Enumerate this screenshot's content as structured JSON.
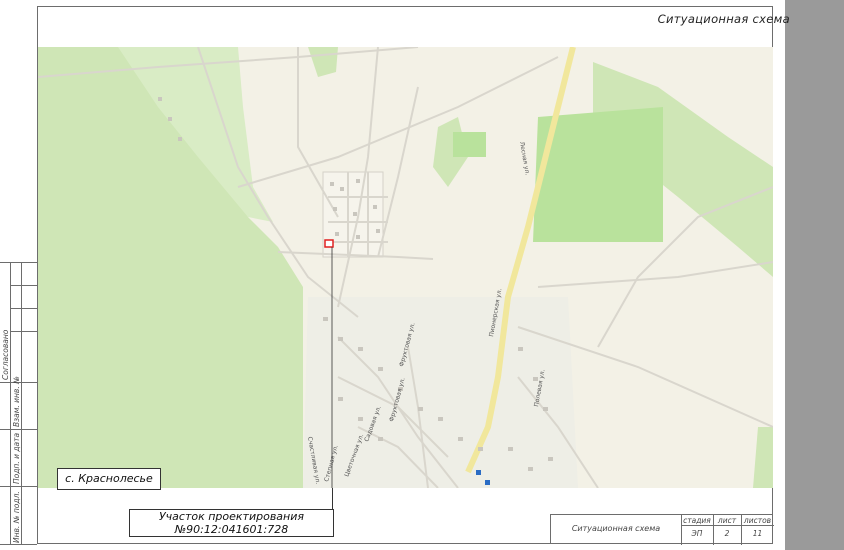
{
  "sheet": {
    "title": "Ситуационная схема",
    "place_name": "с. Краснолесье",
    "plot_label_line1": "Участок проектирования",
    "plot_label_line2": "№90:12:041601:728"
  },
  "side_stamp": {
    "agreed": "Согласовано",
    "ref_inv": "Взам. инв. №",
    "sign_date": "Подп. и дата",
    "inv_orig": "Инв. № подл."
  },
  "title_block": {
    "name": "Ситуационная схема",
    "stage_label": "стадия",
    "sheet_label": "лист",
    "sheets_label": "листов",
    "stage_value": "ЭП",
    "sheet_value": "2",
    "sheets_value": "11"
  },
  "map": {
    "streets": [
      "Пионерская ул.",
      "Фруктовая ул.",
      "Фруктовая ул.",
      "Садовая ул.",
      "Полевая ул.",
      "Цветочная ул.",
      "Степная ул.",
      "Счастливая ул.",
      "Лесная ул."
    ],
    "colors": {
      "background": "#f3f1e6",
      "forest": "#cfe6b6",
      "field": "#b9e29c",
      "main_road": "#f1e79c",
      "road": "#d9d6cd",
      "building": "#c9c6be",
      "plot": "#e02020"
    }
  }
}
